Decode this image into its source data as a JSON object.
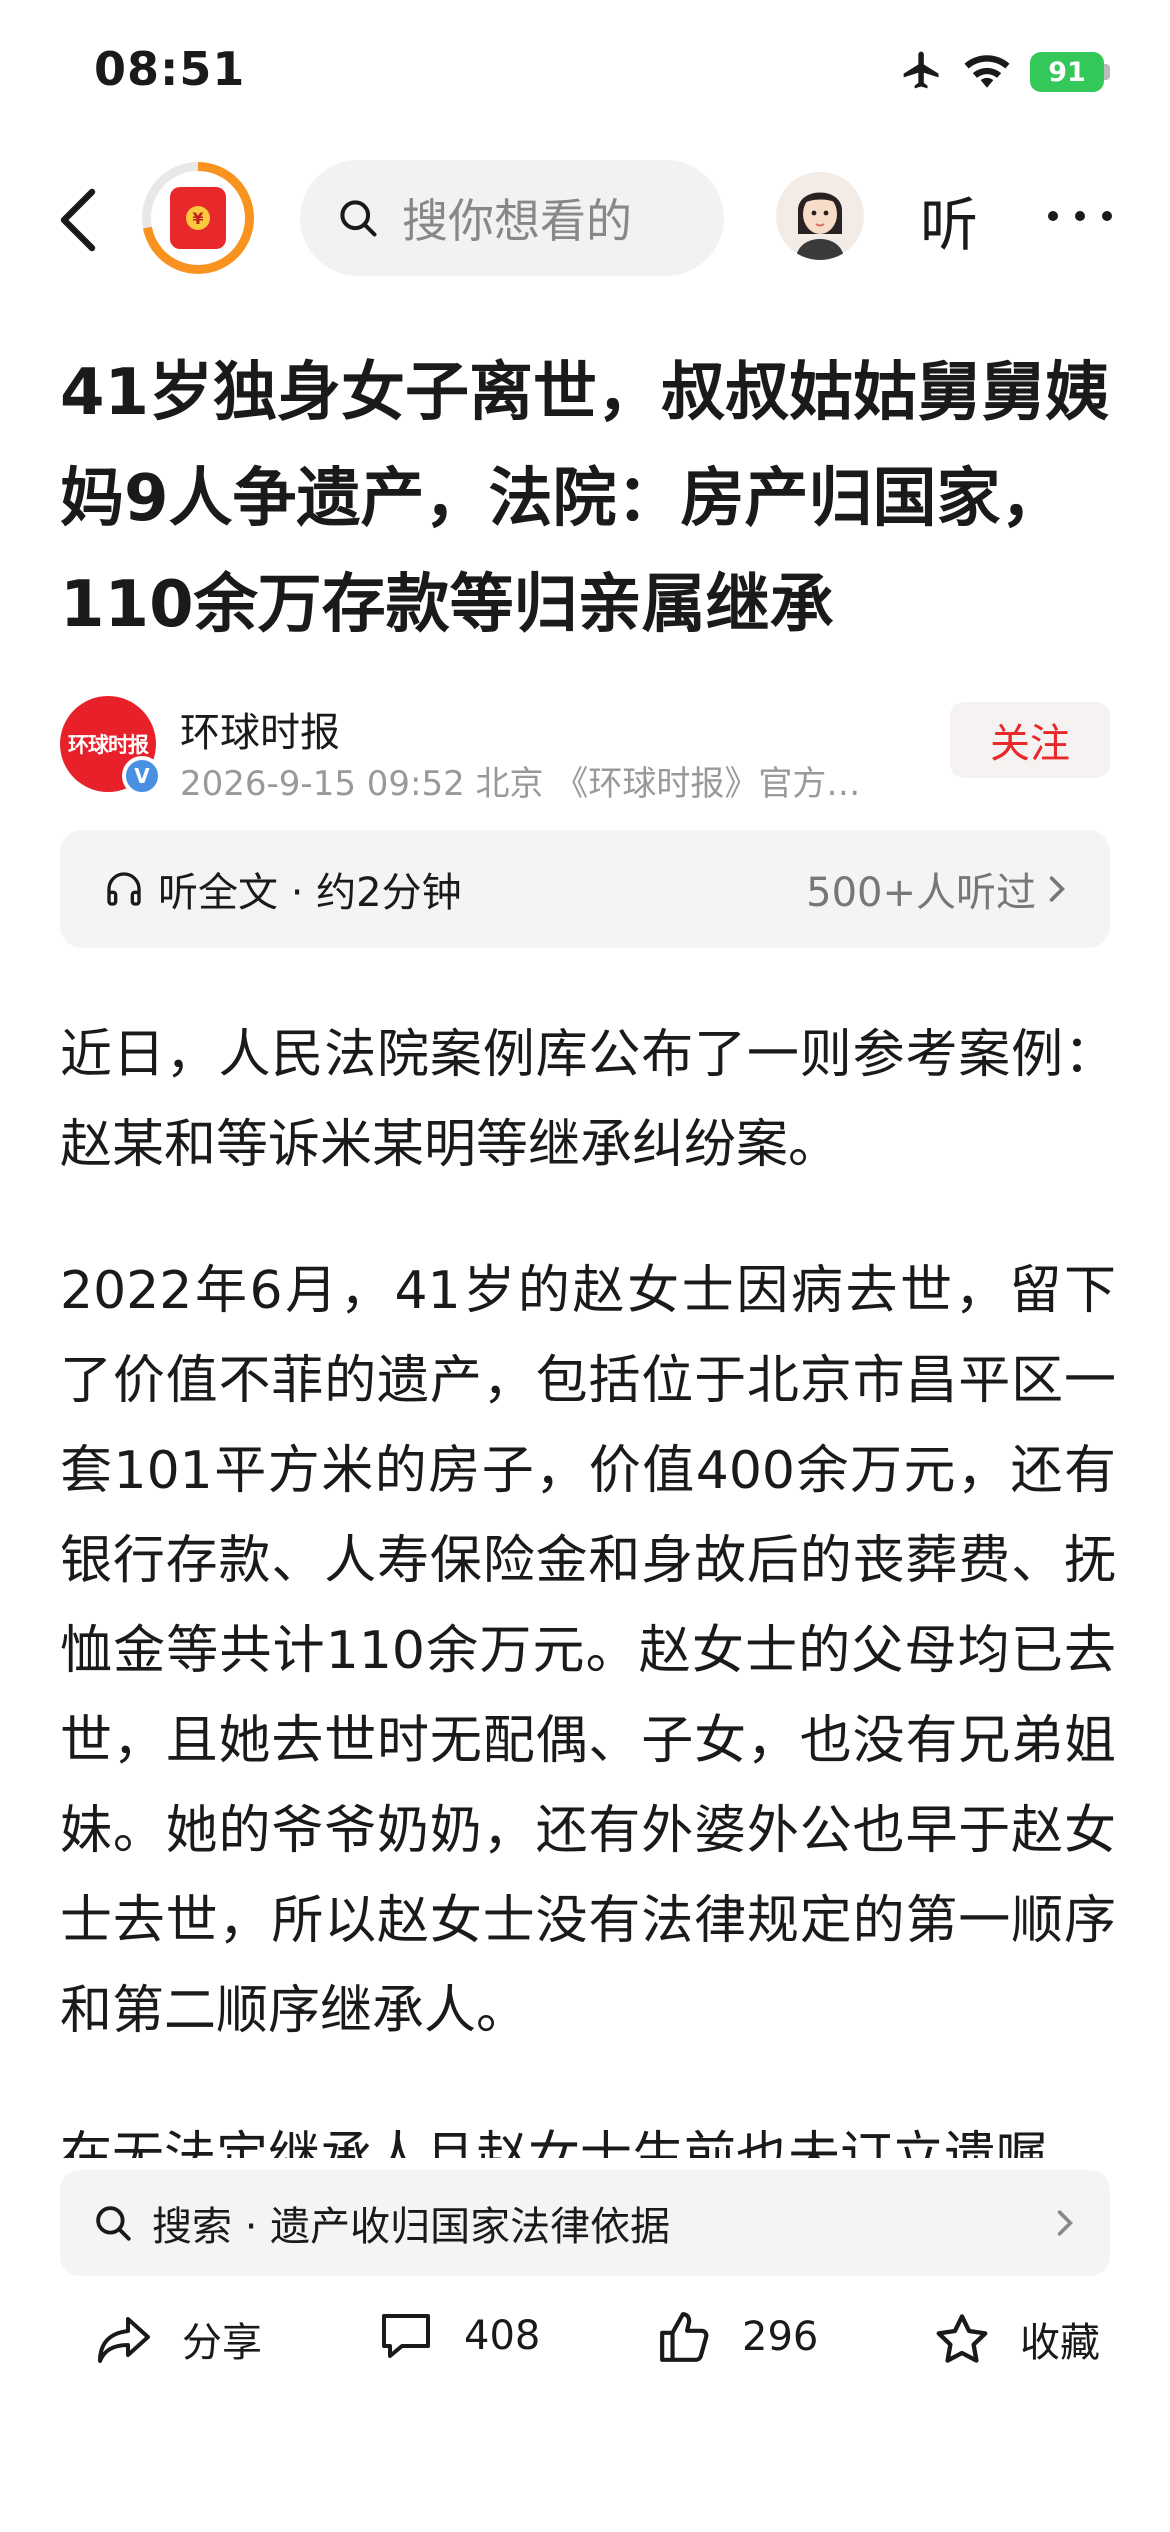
{
  "status_bar": {
    "time": "08:51",
    "battery_level": "91",
    "icons": [
      "airplane-icon",
      "wifi-icon",
      "battery-icon"
    ]
  },
  "nav": {
    "search_placeholder": "搜你想看的",
    "listen_label": "听",
    "icons": [
      "back-arrow-icon",
      "red-envelope-icon",
      "search-icon",
      "avatar",
      "more-icon"
    ]
  },
  "article": {
    "title": "41岁独身女子离世，叔叔姑姑舅舅姨妈9人争遗产，法院：房产归国家，110余万存款等归亲属继承",
    "author": {
      "logo_text": "环球时报",
      "name": "环球时报",
      "meta": "2026-9-15  09:52  北京 《环球时报》官方…",
      "follow_label": "关注"
    },
    "listen_bar": {
      "left_label": "听全文 · 约2分钟",
      "right_label": "500+人听过"
    },
    "paragraphs": [
      "近日，人民法院案例库公布了一则参考案例：赵某和等诉米某明等继承纠纷案。",
      "2022年6月，41岁的赵女士因病去世，留下了价值不菲的遗产，包括位于北京市昌平区一套101平方米的房子，价值400余万元，还有银行存款、人寿保险金和身故后的丧葬费、抚恤金等共计110余万元。赵女士的父母均已去世，且她去世时无配偶、子女，也没有兄弟姐妹。她的爷爷奶奶，还有外婆外公也早于赵女士去世，所以赵女士没有法律规定的第一顺序和第二顺序继承人。",
      "在无法定继承人且赵女士生前也未订立遗嘱"
    ]
  },
  "bottom": {
    "search_label": "搜索 · 遗产收归国家法律依据",
    "actions": {
      "share": "分享",
      "comments": "408",
      "likes": "296",
      "favorite": "收藏"
    }
  },
  "colors": {
    "accent_red": "#e8292b",
    "battery_green": "#34c759",
    "verified_blue": "#4a90e2"
  }
}
